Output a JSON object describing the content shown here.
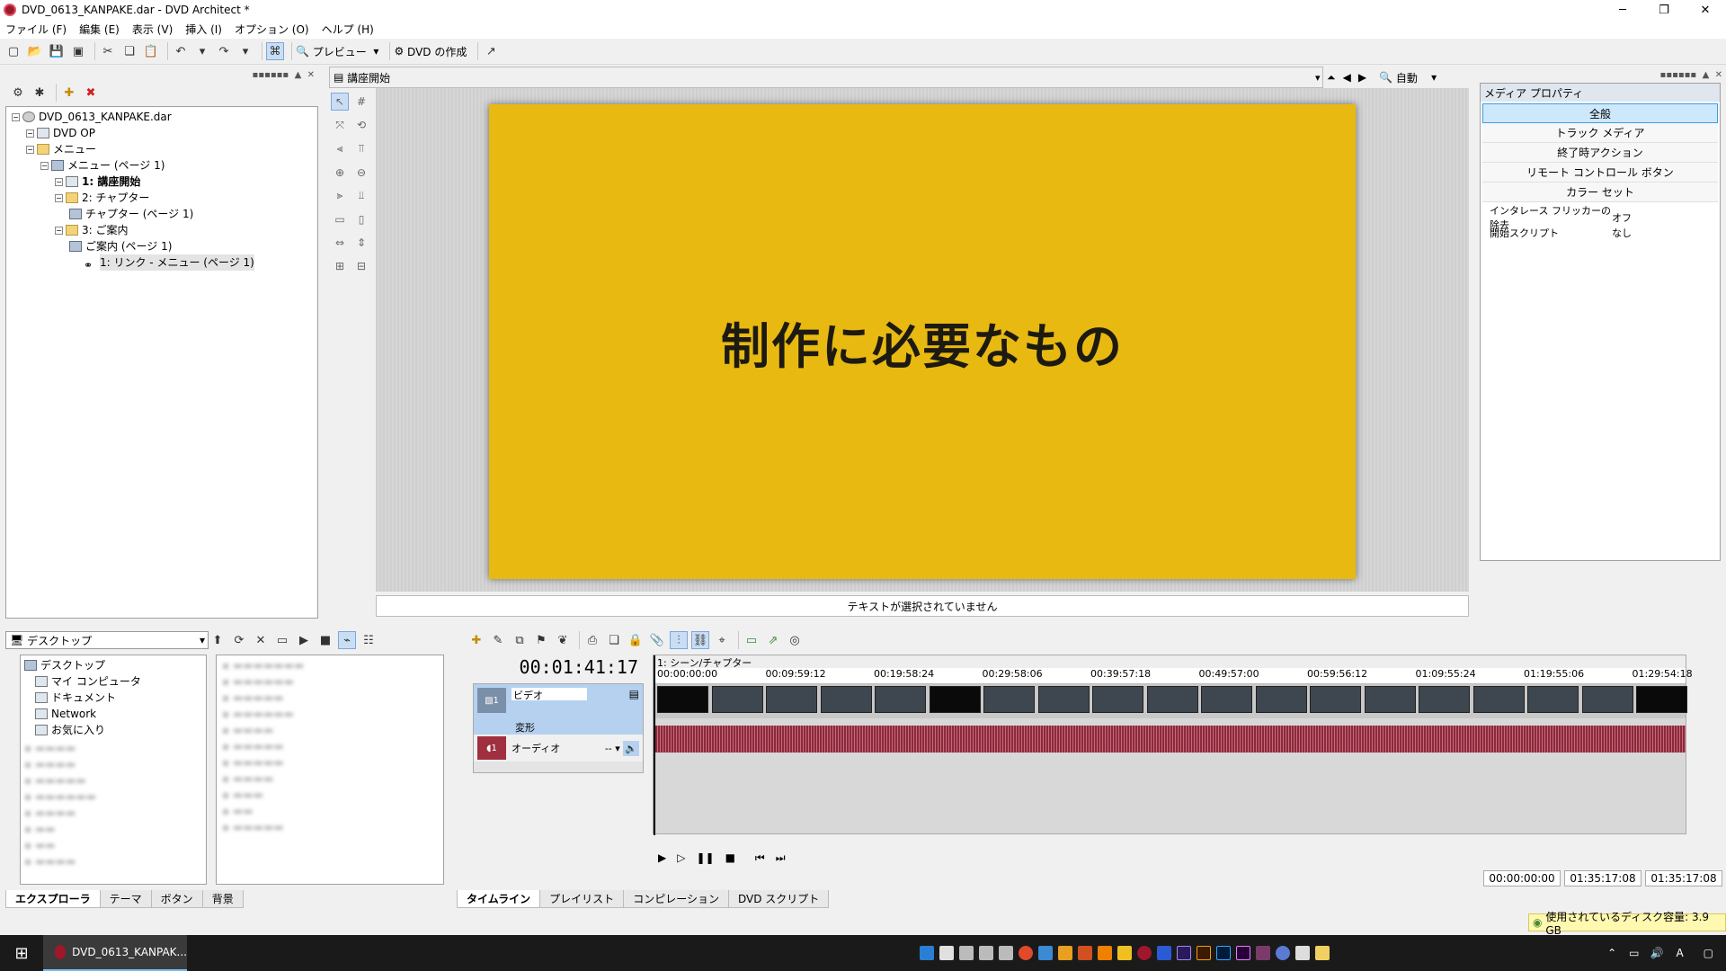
{
  "window": {
    "title": "DVD_0613_KANPAKE.dar - DVD Architect *"
  },
  "menu": [
    "ファイル (F)",
    "編集 (E)",
    "表示 (V)",
    "挿入 (I)",
    "オプション (O)",
    "ヘルプ (H)"
  ],
  "toolbar": {
    "preview_label": "プレビュー",
    "make_dvd_label": "DVD の作成"
  },
  "project_tree": [
    {
      "label": "DVD_0613_KANPAKE.dar",
      "indent": 0,
      "icon": "disc"
    },
    {
      "label": "DVD OP",
      "indent": 1,
      "icon": "film"
    },
    {
      "label": "メニュー",
      "indent": 1,
      "icon": "folder"
    },
    {
      "label": "メニュー (ページ 1)",
      "indent": 2,
      "icon": "menu"
    },
    {
      "label": "1: 講座開始",
      "indent": 3,
      "icon": "film"
    },
    {
      "label": "2: チャプター",
      "indent": 3,
      "icon": "folder"
    },
    {
      "label": "チャプター (ページ 1)",
      "indent": 4,
      "icon": "menu"
    },
    {
      "label": "3: ご案内",
      "indent": 3,
      "icon": "folder"
    },
    {
      "label": "ご案内 (ページ 1)",
      "indent": 4,
      "icon": "menu"
    },
    {
      "label": "1: リンク - メニュー (ページ 1)",
      "indent": 5,
      "icon": "link"
    }
  ],
  "workspace": {
    "title": "講座開始",
    "zoom": "自動",
    "slide_text": "制作に必要なもの",
    "status": "テキストが選択されていません"
  },
  "media_properties": {
    "title": "メディア プロパティ",
    "buttons": [
      "全般",
      "トラック メディア",
      "終了時アクション",
      "リモート コントロール ボタン",
      "カラー セット"
    ],
    "rows": [
      {
        "key": "インタレース フリッカーの除去",
        "value": "オフ"
      },
      {
        "key": "開始スクリプト",
        "value": "なし"
      }
    ]
  },
  "explorer": {
    "location": "デスクトップ",
    "tree": [
      "デスクトップ",
      "マイ コンピュータ",
      "ドキュメント",
      "Network",
      "お気に入り"
    ],
    "tabs": [
      "エクスプローラ",
      "テーマ",
      "ボタン",
      "背景"
    ]
  },
  "timeline": {
    "current_time": "00:01:41:17",
    "scene": "1: シーン/チャプター",
    "ticks": [
      "00:00:00:00",
      "00:09:59:12",
      "00:19:58:24",
      "00:29:58:06",
      "00:39:57:18",
      "00:49:57:00",
      "00:59:56:12",
      "01:09:55:24",
      "01:19:55:06",
      "01:29:54:18"
    ],
    "video_track": "ビデオ",
    "video_sub": "変形",
    "audio_track": "オーディオ",
    "track_num": "1",
    "audio_dash": "--",
    "time_in": "00:00:00:00",
    "time_out": "01:35:17:08",
    "time_len": "01:35:17:08",
    "tabs": [
      "タイムライン",
      "プレイリスト",
      "コンピレーション",
      "DVD スクリプト"
    ]
  },
  "disk_usage": "使用されているディスク容量: 3.9 GB",
  "taskbar": {
    "app_label": "DVD_0613_KANPAK..."
  }
}
